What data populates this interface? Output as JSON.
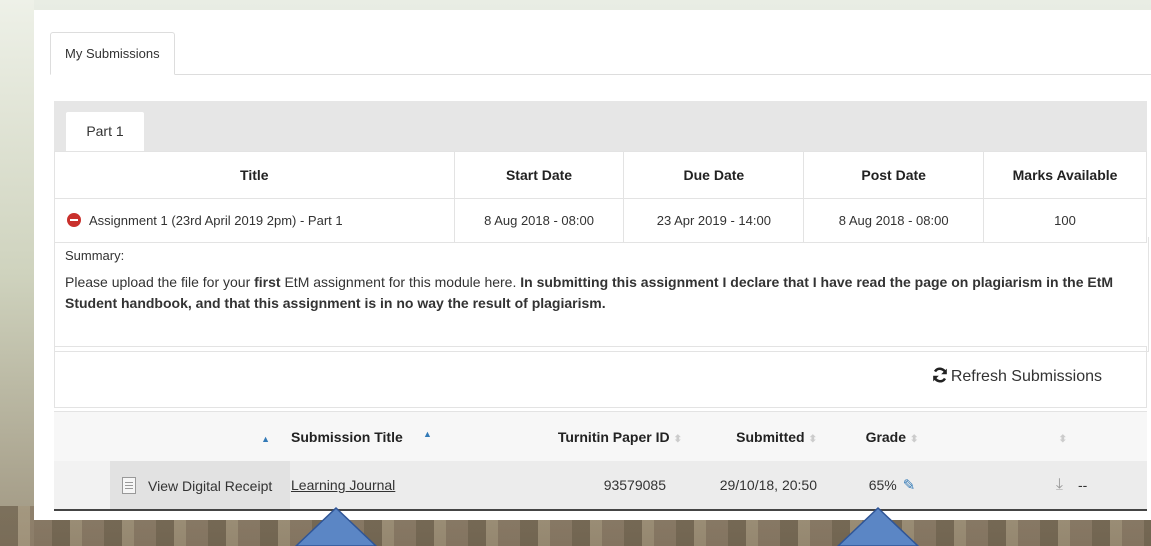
{
  "tabs": {
    "my_submissions": "My Submissions"
  },
  "parts": {
    "active": "Part 1"
  },
  "assignment_table": {
    "headers": [
      "Title",
      "Start Date",
      "Due Date",
      "Post Date",
      "Marks Available"
    ],
    "row": {
      "title": "Assignment 1 (23rd April 2019 2pm) - Part 1",
      "start_date": "8 Aug 2018 - 08:00",
      "due_date": "23 Apr 2019 - 14:00",
      "post_date": "8 Aug 2018 - 08:00",
      "marks": "100"
    }
  },
  "summary": {
    "label": "Summary:",
    "text_1": "Please upload the file for your ",
    "bold_1": "first",
    "text_2": " EtM assignment for this module here. ",
    "bold_2": "In submitting this assignment I declare that I have read the page on plagiarism in the EtM Student handbook, and that this assignment is in no way the result of plagiarism."
  },
  "refresh": {
    "label": "Refresh Submissions"
  },
  "submissions": {
    "headers": {
      "submission_title": "Submission Title",
      "paper_id": "Turnitin Paper ID",
      "submitted": "Submitted",
      "grade": "Grade"
    },
    "row": {
      "receipt": "View Digital Receipt",
      "title": "Learning Journal",
      "paper_id": "93579085",
      "submitted": "29/10/18, 20:50",
      "grade": "65%",
      "extra": "--"
    }
  },
  "colors": {
    "accent": "#337ab7",
    "arrow": "#5b86c5",
    "danger": "#c9302c"
  },
  "icons": [
    "minus-circle-icon",
    "refresh-icon",
    "document-icon",
    "pencil-icon",
    "download-icon",
    "sort-icon",
    "arrow-up-icon"
  ]
}
